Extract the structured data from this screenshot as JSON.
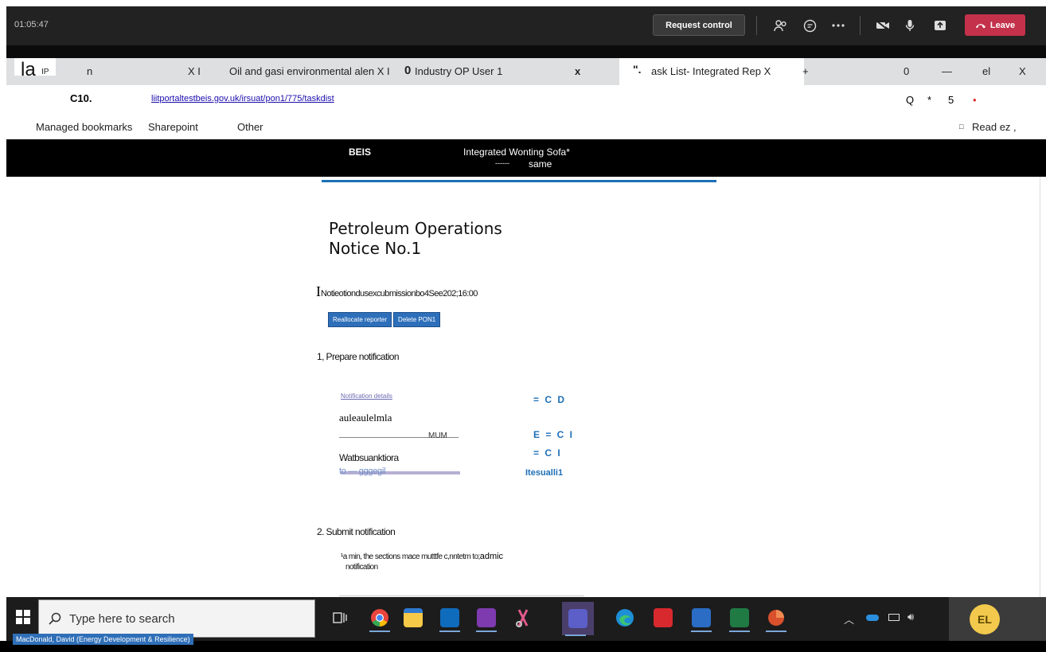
{
  "meeting": {
    "timer": "01:05:47",
    "request_control_label": "Request control",
    "leave_label": "Leave",
    "accent_leave": "#c4314b"
  },
  "browser": {
    "tab1_left": "la",
    "tab1_icon_text": "IP",
    "tab1_label": "n",
    "tab1_close": "X I",
    "tab2_label": "Oil and gasi environmental alen X I",
    "tab3_prefix": "0",
    "tab3_label": "Industry OP User 1",
    "tab3_close": "x",
    "active_tab_prefix": "\".",
    "active_tab_label": "ask List- Integrated Rep X",
    "new_tab": "+",
    "ctrl_0": "0",
    "ctrl_min": "—",
    "ctrl_el": "el",
    "ctrl_x": "X",
    "addr_left": "C10.",
    "url": "liitportaltestbeis.gov.uk/irsuat/pon1/775/taskdist",
    "addr_right_q": "Q",
    "addr_right_star": "*",
    "addr_right_5": "5",
    "addr_right_dot": "•",
    "bookmarks": [
      "Managed bookmarks",
      "Sharepoint",
      "Other"
    ],
    "reading_list_icon": "□",
    "reading_list": "Read ez ,"
  },
  "site": {
    "brand": "BEIS",
    "service_name": "Integrated Wonting Sofa*",
    "sub_dashes": "------",
    "sub_text": "same"
  },
  "page": {
    "title_line1": "Petroleum Operations",
    "title_line2": "Notice No.1",
    "meta_prefix": "I",
    "meta_text": "Notieotiondusexcubmissionbo4See202;16:00",
    "reallocate_label": "Reallocate reporter",
    "delete_label": "Delete PON1",
    "section1_heading": "1, Prepare notification",
    "tasks": [
      {
        "label": "Notification details",
        "status": "= C D"
      },
      {
        "label": "auleaulelmla",
        "status": ""
      },
      {
        "label": "MUM",
        "status": "E = C I"
      },
      {
        "label": "Watbsuanktiora",
        "status": "= C I"
      },
      {
        "label": "to — gggegil",
        "status": "Itesualli1"
      }
    ],
    "section2_heading": "2. Submit notification",
    "submit_line1": "¹a min, the sections mace mutttfe c,nntetm to;",
    "submit_line1_tail": "admic",
    "submit_line2": "notification"
  },
  "taskbar": {
    "search_placeholder": "Type here to search",
    "presenter": "MacDonald, David (Energy Development & Resilience)",
    "avatar_initials": "EL"
  }
}
